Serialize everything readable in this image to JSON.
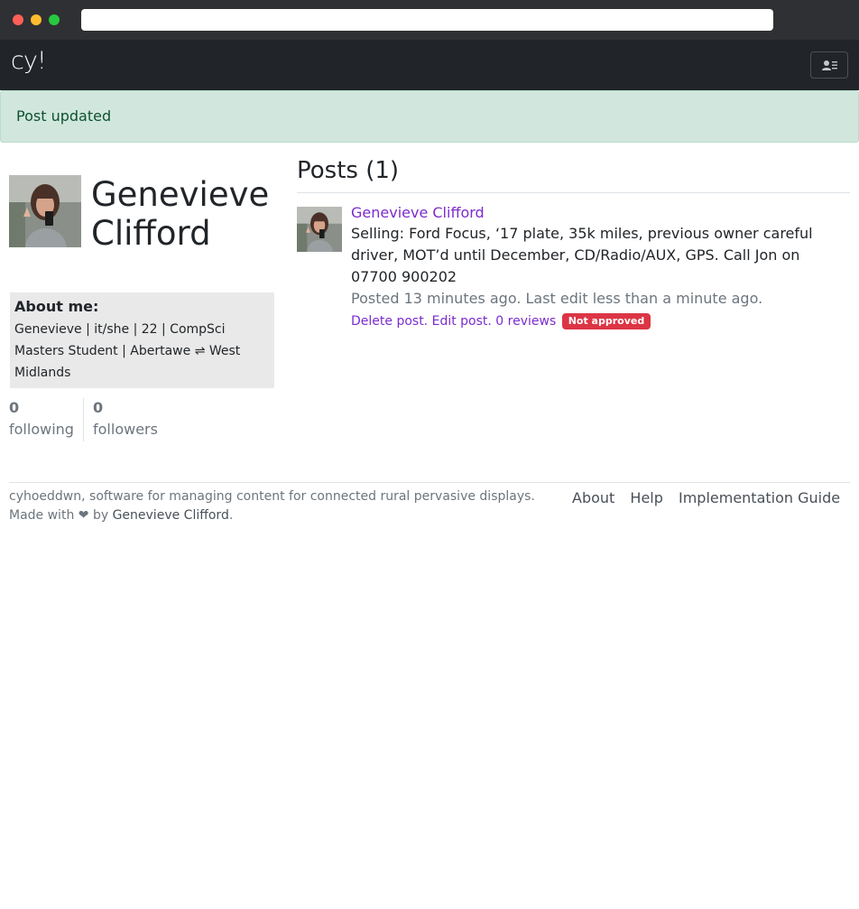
{
  "browser": {
    "url": ""
  },
  "navbar": {
    "brand": "cy!",
    "user_menu_icon": "user-card-icon"
  },
  "alert": {
    "message": "Post updated",
    "color": "#d1e7dd"
  },
  "profile": {
    "name": "Genevieve Clifford",
    "about_title": "About me:",
    "about_text": "Genevieve | it/she | 22 | CompSci Masters Student | Abertawe ⇌ West Midlands",
    "following_count": "0",
    "following_label": "following",
    "followers_count": "0",
    "followers_label": "followers"
  },
  "posts": {
    "heading": "Posts (1)",
    "items": [
      {
        "author": "Genevieve Clifford",
        "body": "Selling: Ford Focus, ‘17 plate, 35k miles, previous owner careful driver, MOT’d until December, CD/Radio/AUX, GPS. Call Jon on 07700 900202",
        "meta": "Posted 13 minutes ago. Last edit less than a minute ago.",
        "delete_label": "Delete post.",
        "edit_label": "Edit post.",
        "reviews_label": "0 reviews",
        "status_badge": "Not approved",
        "status_color": "#dc3545"
      }
    ]
  },
  "footer": {
    "description": "cyhoeddwn, software for managing content for connected rural pervasive displays.",
    "made_with_prefix": "Made with",
    "heart": "❤",
    "by": "by",
    "author_link": "Genevieve Clifford",
    "links": [
      "About",
      "Help",
      "Implementation Guide"
    ]
  },
  "colors": {
    "link": "#7b2ccf",
    "navbar": "#212529"
  }
}
